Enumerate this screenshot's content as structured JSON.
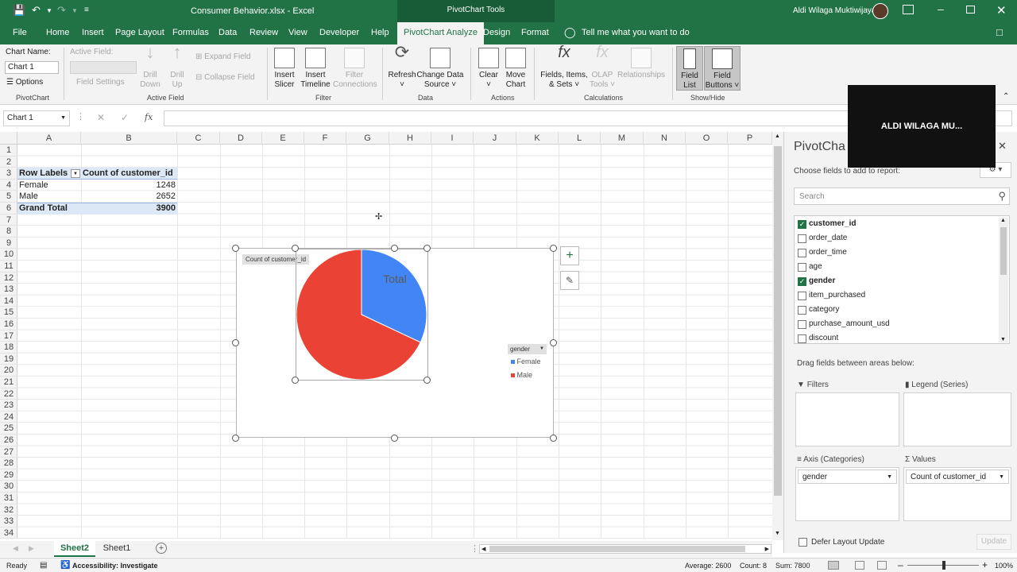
{
  "window": {
    "title": "Consumer Behavior.xlsx  -  Excel",
    "context_tab": "PivotChart Tools",
    "user": "Aldi Wilaga Muktiwijaya"
  },
  "tabs": [
    "File",
    "Home",
    "Insert",
    "Page Layout",
    "Formulas",
    "Data",
    "Review",
    "View",
    "Developer",
    "Help",
    "PivotChart Analyze",
    "Design",
    "Format"
  ],
  "tell_me": "Tell me what you want to do",
  "ribbon": {
    "chart_name_label": "Chart Name:",
    "chart_name_value": "Chart 1",
    "options": "Options",
    "pivotchart_group": "PivotChart",
    "active_field_label": "Active Field:",
    "field_settings": "Field Settings",
    "drill_down": [
      "Drill",
      "Down"
    ],
    "drill_up": [
      "Drill",
      "Up"
    ],
    "expand_field": "Expand Field",
    "collapse_field": "Collapse Field",
    "active_field_group": "Active Field",
    "insert_slicer": [
      "Insert",
      "Slicer"
    ],
    "insert_timeline": [
      "Insert",
      "Timeline"
    ],
    "filter_connections": [
      "Filter",
      "Connections"
    ],
    "filter_group": "Filter",
    "refresh": "Refresh",
    "change_data_source": [
      "Change Data",
      "Source"
    ],
    "data_group": "Data",
    "clear": "Clear",
    "move_chart": [
      "Move",
      "Chart"
    ],
    "actions_group": "Actions",
    "fields_items_sets": [
      "Fields, Items,",
      "& Sets"
    ],
    "olap_tools": [
      "OLAP",
      "Tools"
    ],
    "relationships": "Relationships",
    "calculations_group": "Calculations",
    "field_list": [
      "Field",
      "List"
    ],
    "field_buttons": [
      "Field",
      "Buttons"
    ],
    "showhide_group": "Show/Hide"
  },
  "formula_bar": {
    "name_box": "Chart 1",
    "fx": "fx",
    "formula": ""
  },
  "columns": [
    "A",
    "B",
    "C",
    "D",
    "E",
    "F",
    "G",
    "H",
    "I",
    "J",
    "K",
    "L",
    "M",
    "N",
    "O",
    "P"
  ],
  "rows": [
    "1",
    "2",
    "3",
    "4",
    "5",
    "6",
    "7",
    "8",
    "9",
    "10",
    "11",
    "12",
    "13",
    "14",
    "15",
    "16",
    "17",
    "18",
    "19",
    "20",
    "21",
    "22",
    "23",
    "24",
    "25",
    "26",
    "27",
    "28",
    "29",
    "30",
    "31",
    "32",
    "33",
    "34"
  ],
  "pivot": {
    "header_labels": "Row Labels",
    "header_value": "Count of customer_id",
    "rows": [
      {
        "label": "Female",
        "value": "1248"
      },
      {
        "label": "Male",
        "value": "2652"
      }
    ],
    "total_label": "Grand Total",
    "total_value": "3900"
  },
  "chart": {
    "field_button": "Count  of customer_id",
    "title": "Total",
    "legend_field": "gender",
    "legend": [
      {
        "name": "Female",
        "color": "#4285f4"
      },
      {
        "name": "Male",
        "color": "#ea4335"
      }
    ]
  },
  "chart_data": {
    "type": "pie",
    "title": "Total",
    "categories": [
      "Female",
      "Male"
    ],
    "values": [
      1248,
      2652
    ],
    "colors": [
      "#4285f4",
      "#ea4335"
    ],
    "legend_position": "right"
  },
  "panel": {
    "title": "PivotCha",
    "choose": "Choose fields to add to report:",
    "search_placeholder": "Search",
    "fields": [
      {
        "name": "customer_id",
        "checked": true
      },
      {
        "name": "order_date",
        "checked": false
      },
      {
        "name": "order_time",
        "checked": false
      },
      {
        "name": "age",
        "checked": false
      },
      {
        "name": "gender",
        "checked": true
      },
      {
        "name": "item_purchased",
        "checked": false
      },
      {
        "name": "category",
        "checked": false
      },
      {
        "name": "purchase_amount_usd",
        "checked": false
      },
      {
        "name": "discount",
        "checked": false
      }
    ],
    "drag_label": "Drag fields between areas below:",
    "filters": "Filters",
    "legend_series": "Legend (Series)",
    "axis_categories": "Axis (Categories)",
    "values": "Values",
    "axis_item": "gender",
    "values_item": "Count of customer_id",
    "defer": "Defer Layout Update",
    "update": "Update"
  },
  "sheets": [
    "Sheet2",
    "Sheet1"
  ],
  "status": {
    "ready": "Ready",
    "accessibility": "Accessibility: Investigate",
    "average": "Average: 2600",
    "count": "Count: 8",
    "sum": "Sum: 7800",
    "zoom": "100%"
  },
  "webcam_label": "ALDI WILAGA MU..."
}
